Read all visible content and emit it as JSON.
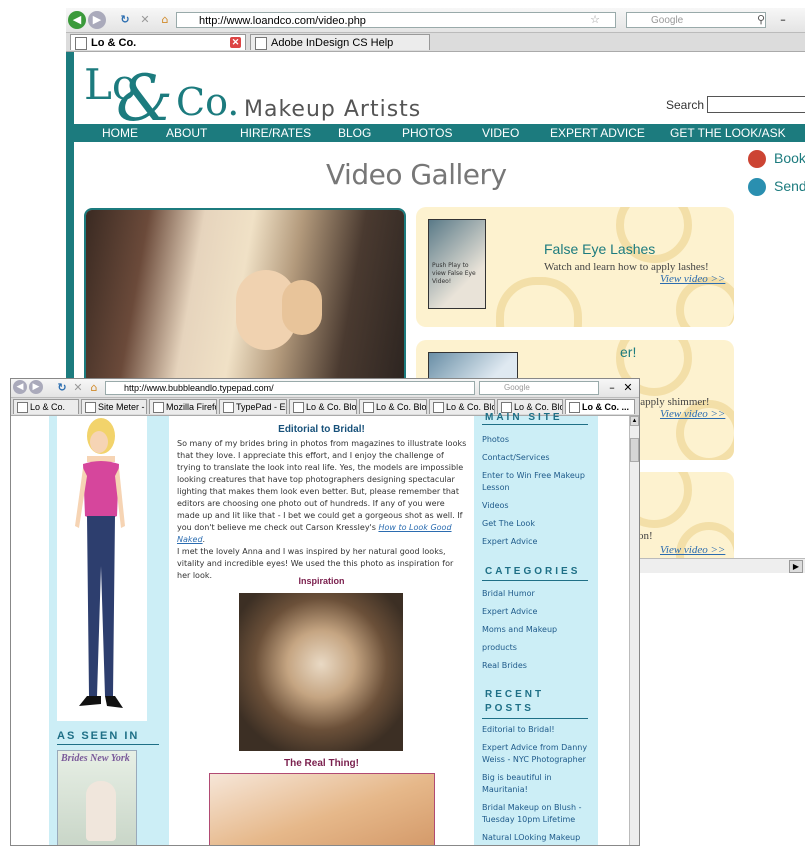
{
  "back_window": {
    "url": "http://www.loandco.com/video.php",
    "search_placeholder": "Google",
    "tabs": [
      {
        "label": "Lo & Co.",
        "active": true
      },
      {
        "label": "Adobe InDesign CS Help",
        "active": false
      }
    ],
    "site": {
      "logo_lo": "Lo",
      "logo_amp": "&",
      "logo_co": "Co.",
      "logo_sub": "Makeup Artists",
      "search_label": "Search",
      "nav": [
        "HOME",
        "ABOUT",
        "HIRE/RATES",
        "BLOG",
        "PHOTOS",
        "VIDEO",
        "EXPERT ADVICE",
        "GET THE LOOK/ASK"
      ],
      "page_title": "Video Gallery",
      "side_links": [
        "Book",
        "Send"
      ],
      "videos": [
        {
          "title": "False Eye Lashes",
          "desc": "Watch and learn how to apply lashes!",
          "link": "View video >>",
          "thumb_caption": "Push Play to view False Eye Video!"
        },
        {
          "title": "er!",
          "desc": "o apply shimmer!",
          "link": "View video >>"
        },
        {
          "title": "",
          "desc": "on!",
          "link": "View video >>"
        }
      ],
      "accent": "#1c7b7e"
    }
  },
  "front_window": {
    "url": "http://www.bubbleandlo.typepad.com/",
    "search_placeholder": "Google",
    "tabs": [
      {
        "label": "Lo & Co."
      },
      {
        "label": "Site Meter - C..."
      },
      {
        "label": "Mozilla Firefox..."
      },
      {
        "label": "TypePad - Edit..."
      },
      {
        "label": "Lo & Co. Blog"
      },
      {
        "label": "Lo & Co. Blog"
      },
      {
        "label": "Lo & Co. Blog"
      },
      {
        "label": "Lo & Co. Blog"
      },
      {
        "label": "Lo & Co. ...",
        "active": true
      }
    ],
    "blog": {
      "as_seen_in": "AS SEEN IN",
      "magazine_title": "Brides New York",
      "post_title": "Editorial to Bridal!",
      "para1": "So many of my brides bring in photos from magazines to illustrate looks that they love.  I appreciate this effort, and I enjoy the challenge of trying to translate the look into real life.  Yes, the models are impossible looking creatures that have top photographers designing spectacular lighting that makes them look even better.  But, please remember that editors are choosing one photo out of hundreds.  If any of you were made up and lit like that - I bet we could get a gorgeous shot as well.  If you don't believe me check out Carson Kressley's",
      "para1_link": "How to Look Good Naked",
      "para2": "I met the lovely Anna and I was inspired by her natural good looks, vitality and incredible eyes!  We used the this photo as inspiration for her look.",
      "inspiration_title": "Inspiration",
      "real_title": "The Real Thing!",
      "sidebar": {
        "main_site_title": "MAIN SITE",
        "main_site_links": [
          "Photos",
          "Contact/Services",
          "Enter to Win Free Makeup Lesson",
          "Videos",
          "Get The Look",
          "Expert Advice"
        ],
        "categories_title": "CATEGORIES",
        "categories": [
          "Bridal Humor",
          "Expert Advice",
          "Moms and Makeup",
          "products",
          "Real Brides"
        ],
        "recent_title": "RECENT POSTS",
        "recent_posts": [
          "Editorial to Bridal!",
          "Expert Advice from Danny Weiss - NYC Photographer",
          "Big is beautiful in Mauritania!",
          "Bridal Makeup on Blush - Tuesday 10pm Lifetime",
          "Natural LOoking Makeup"
        ]
      }
    }
  }
}
